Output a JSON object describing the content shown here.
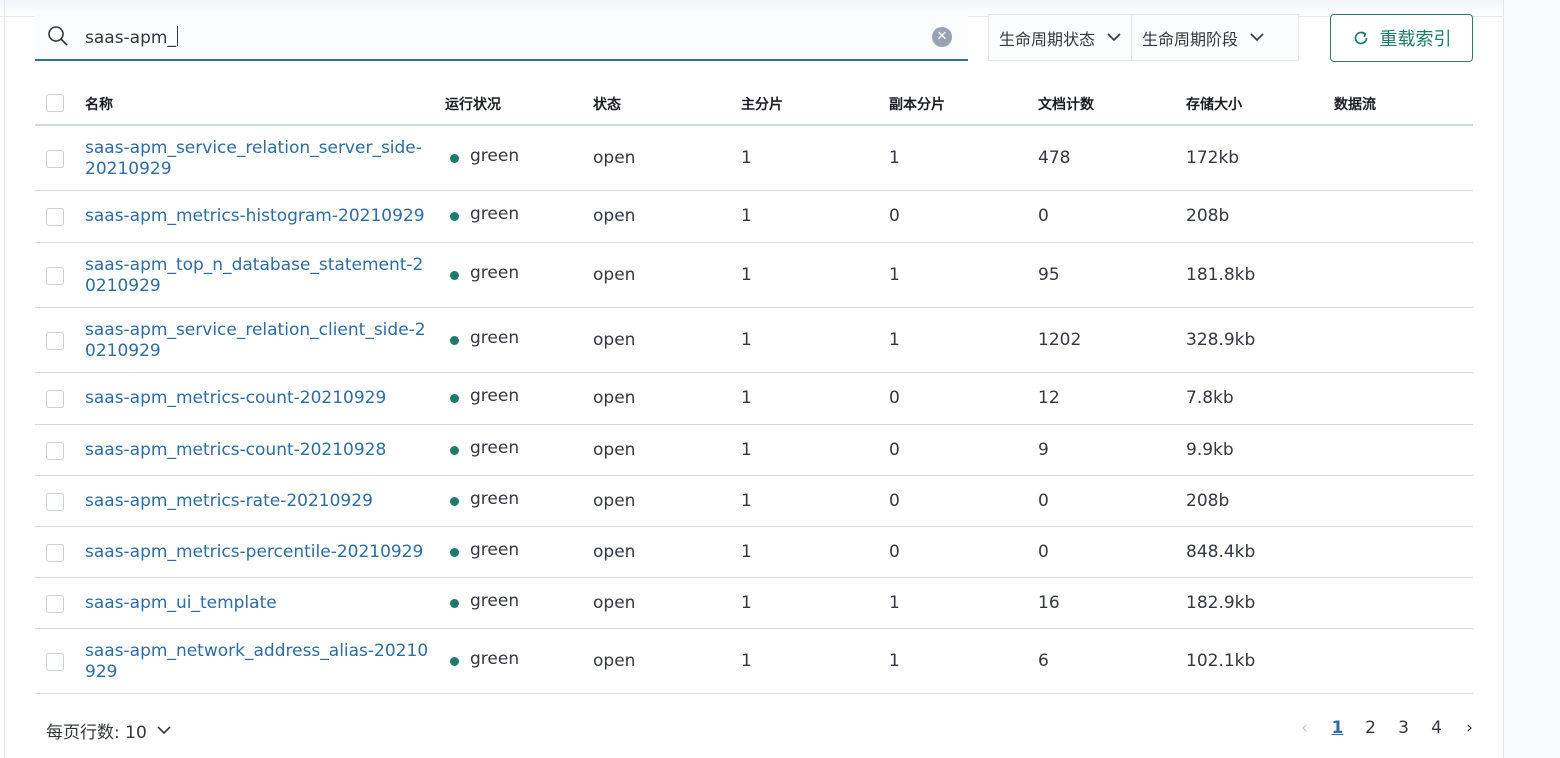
{
  "search": {
    "value": "saas-apm_"
  },
  "filters": {
    "lifecycle_status": "生命周期状态",
    "lifecycle_phase": "生命周期阶段"
  },
  "reload_label": "重载索引",
  "columns": [
    "名称",
    "运行状况",
    "状态",
    "主分片",
    "副本分片",
    "文档计数",
    "存储大小",
    "数据流"
  ],
  "rows": [
    {
      "name": "saas-apm_service_relation_server_side-20210929",
      "health": "green",
      "status": "open",
      "primary": "1",
      "replica": "1",
      "docs": "478",
      "size": "172kb",
      "datastream": ""
    },
    {
      "name": "saas-apm_metrics-histogram-20210929",
      "health": "green",
      "status": "open",
      "primary": "1",
      "replica": "0",
      "docs": "0",
      "size": "208b",
      "datastream": ""
    },
    {
      "name": "saas-apm_top_n_database_statement-20210929",
      "health": "green",
      "status": "open",
      "primary": "1",
      "replica": "1",
      "docs": "95",
      "size": "181.8kb",
      "datastream": ""
    },
    {
      "name": "saas-apm_service_relation_client_side-20210929",
      "health": "green",
      "status": "open",
      "primary": "1",
      "replica": "1",
      "docs": "1202",
      "size": "328.9kb",
      "datastream": ""
    },
    {
      "name": "saas-apm_metrics-count-20210929",
      "health": "green",
      "status": "open",
      "primary": "1",
      "replica": "0",
      "docs": "12",
      "size": "7.8kb",
      "datastream": ""
    },
    {
      "name": "saas-apm_metrics-count-20210928",
      "health": "green",
      "status": "open",
      "primary": "1",
      "replica": "0",
      "docs": "9",
      "size": "9.9kb",
      "datastream": ""
    },
    {
      "name": "saas-apm_metrics-rate-20210929",
      "health": "green",
      "status": "open",
      "primary": "1",
      "replica": "0",
      "docs": "0",
      "size": "208b",
      "datastream": ""
    },
    {
      "name": "saas-apm_metrics-percentile-20210929",
      "health": "green",
      "status": "open",
      "primary": "1",
      "replica": "0",
      "docs": "0",
      "size": "848.4kb",
      "datastream": ""
    },
    {
      "name": "saas-apm_ui_template",
      "health": "green",
      "status": "open",
      "primary": "1",
      "replica": "1",
      "docs": "16",
      "size": "182.9kb",
      "datastream": ""
    },
    {
      "name": "saas-apm_network_address_alias-20210929",
      "health": "green",
      "status": "open",
      "primary": "1",
      "replica": "1",
      "docs": "6",
      "size": "102.1kb",
      "datastream": ""
    }
  ],
  "footer": {
    "rows_per_page": "每页行数: 10"
  },
  "pagination": {
    "pages": [
      "1",
      "2",
      "3",
      "4"
    ],
    "current": "1"
  },
  "colors": {
    "accent": "#2e6ca1",
    "health_green": "#1e7a6b",
    "primary_button": "#1e7a6b"
  }
}
